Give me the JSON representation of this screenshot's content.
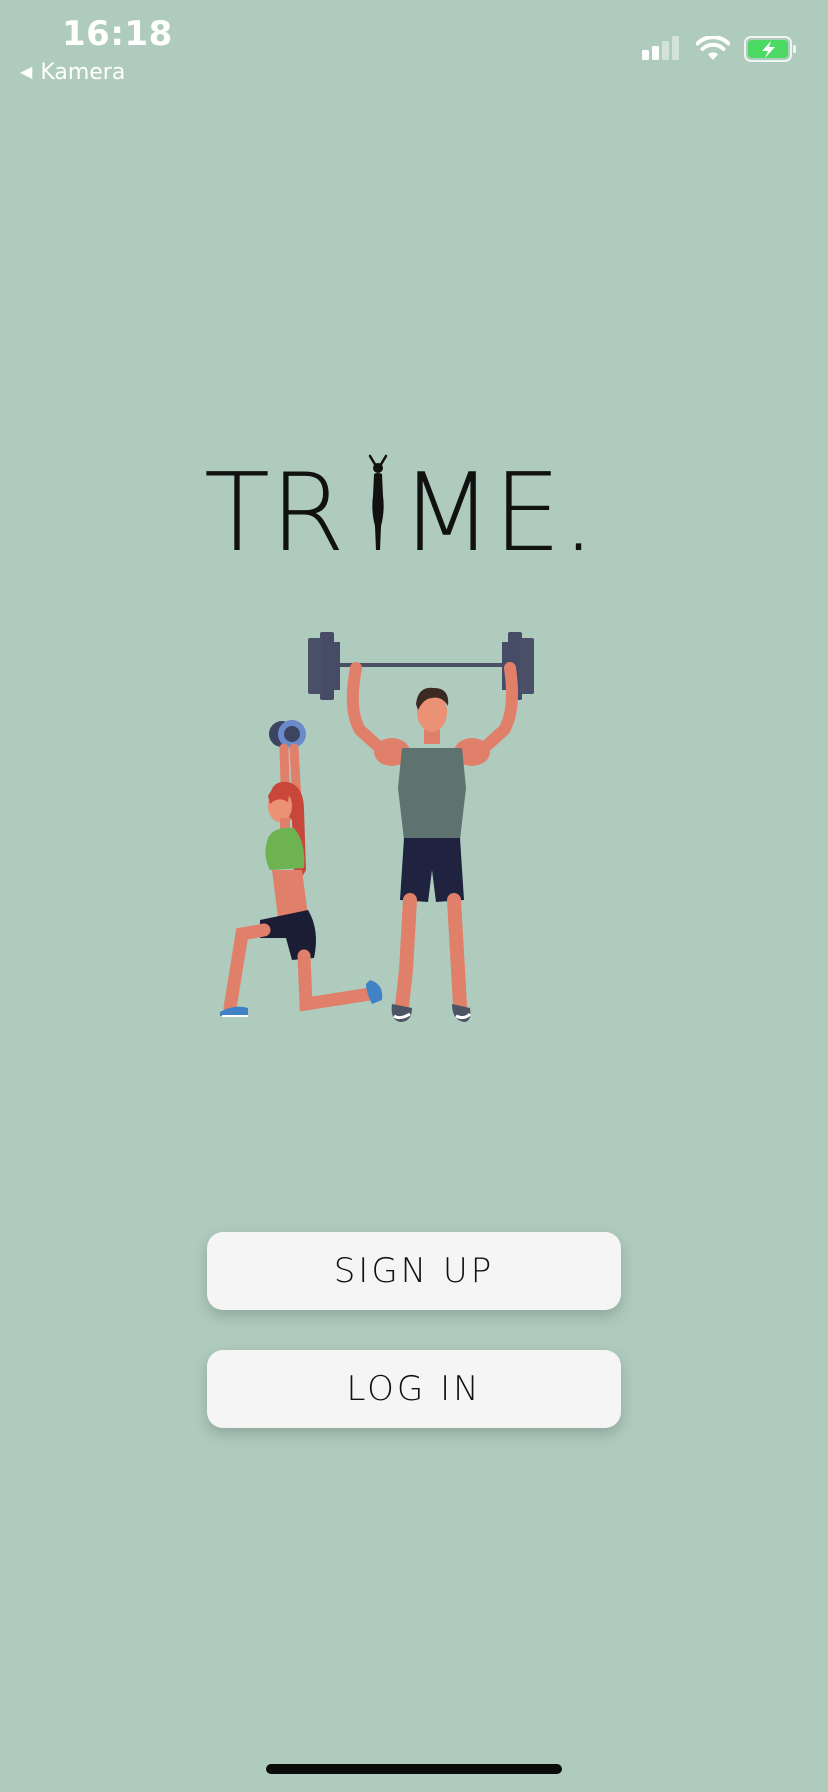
{
  "status_bar": {
    "time": "16:18",
    "back_label": "Kamera",
    "battery_color": "#4cd964"
  },
  "logo": {
    "text_left": "TR",
    "text_right": "ME."
  },
  "buttons": {
    "signup_label": "SIGN UP",
    "login_label": "LOG IN"
  },
  "colors": {
    "background": "#afcbbe",
    "button_bg": "#f5f5f5"
  }
}
